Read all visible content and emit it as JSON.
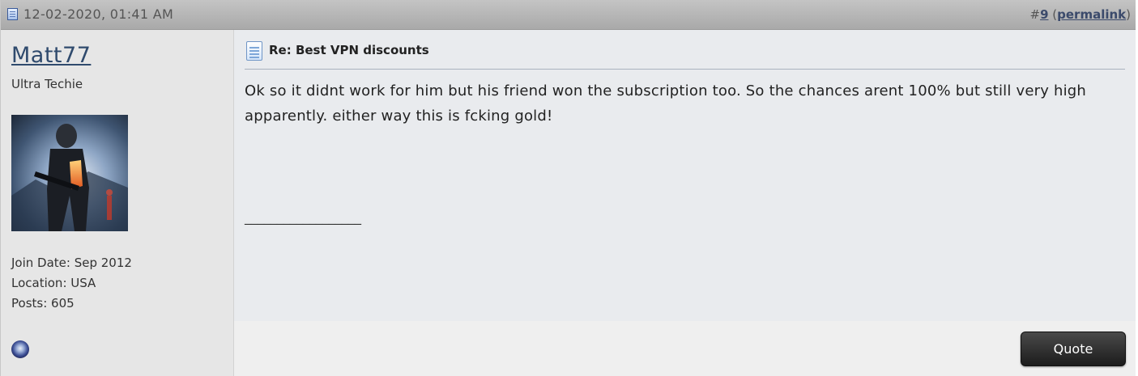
{
  "post": {
    "date": "12-02-2020, 01:41 AM",
    "number_prefix": "#",
    "number": "9",
    "paren_open": "(",
    "permalink_label": "permalink",
    "paren_close": ")"
  },
  "user": {
    "name": "Matt77",
    "title": "Ultra Techie",
    "join_date": "Join Date: Sep 2012",
    "location": "Location: USA",
    "posts": "Posts: 605",
    "status_icon": "online-status-icon"
  },
  "body": {
    "title": "Re: Best VPN discounts",
    "message": "Ok so it didnt work for him but his friend won the subscription too. So the chances arent 100% but still very high apparently. either way this is fcking gold!",
    "signature": "__________________"
  },
  "footer": {
    "quote_label": "Quote"
  }
}
